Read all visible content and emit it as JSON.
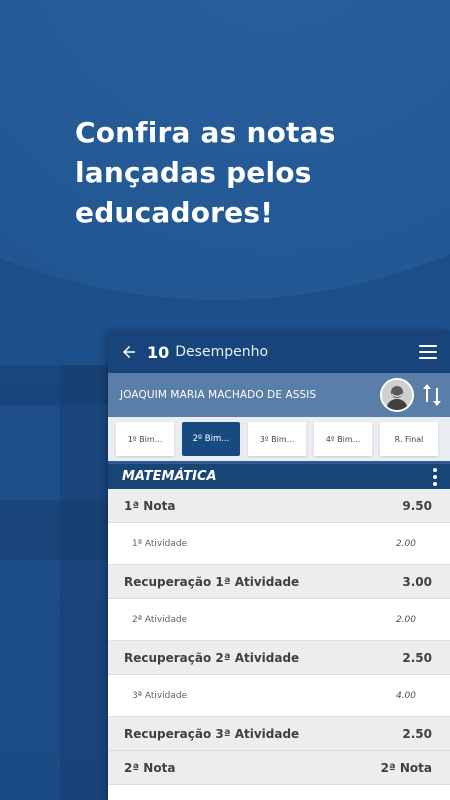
{
  "headline": {
    "line1": "Confira as notas",
    "line2": "lançadas pelos",
    "line3": "educadores!"
  },
  "appbar": {
    "back_icon": "arrow-left-icon",
    "number": "10",
    "title": "Desempenho",
    "menu_icon": "hamburger-menu-icon"
  },
  "student": {
    "name": "JOAQUIM MARIA MACHADO DE ASSIS",
    "avatar_icon": "student-avatar",
    "swap_icon": "swap-vertical-icon"
  },
  "tabs": [
    {
      "label": "1º Bim...",
      "active": false
    },
    {
      "label": "2º Bim...",
      "active": true
    },
    {
      "label": "3º Bim...",
      "active": false
    },
    {
      "label": "4º Bim...",
      "active": false
    },
    {
      "label": "R. Final",
      "active": false
    }
  ],
  "subject": {
    "name": "MATEMÁTICA",
    "more_icon": "more-vertical-icon"
  },
  "grades": [
    {
      "type": "main",
      "label": "1ª Nota",
      "value": "9.50"
    },
    {
      "type": "sub",
      "label": "1ª Atividade",
      "value": "2.00"
    },
    {
      "type": "main",
      "label": "Recuperação 1ª Atividade",
      "value": "3.00"
    },
    {
      "type": "sub",
      "label": "2ª Atividade",
      "value": "2.00"
    },
    {
      "type": "main",
      "label": "Recuperação 2ª Atividade",
      "value": "2.50"
    },
    {
      "type": "sub",
      "label": "3ª Atividade",
      "value": "4.00"
    },
    {
      "type": "main",
      "label": "Recuperação 3ª Atividade",
      "value": "2.50"
    },
    {
      "type": "main",
      "label": "2ª Nota",
      "value": "2ª Nota"
    }
  ],
  "colors": {
    "primary": "#17457b",
    "student_bar": "#597ea8",
    "active_tab": "#184a82"
  }
}
